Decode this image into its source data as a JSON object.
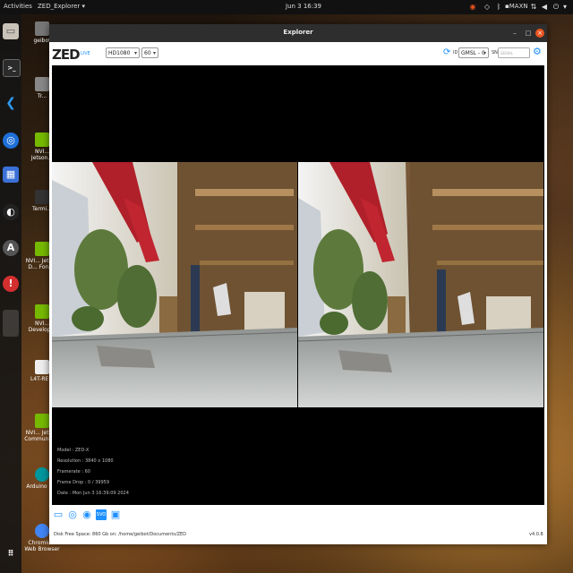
{
  "topbar": {
    "activities": "Activities",
    "app_menu": "ZED_Explorer ▾",
    "clock": "Jun 3 16:39",
    "power_mode": "MAXN",
    "icons": [
      "nvidia-icon",
      "wifi-icon",
      "bluetooth-icon",
      "network-icon",
      "volume-icon",
      "power-icon"
    ]
  },
  "dock": {
    "items": [
      "files-icon",
      "terminal-icon",
      "vscode-icon",
      "chromium-icon",
      "screenshot-icon",
      "obs-icon",
      "arduino-icon",
      "help-icon",
      "apps-grid-icon"
    ]
  },
  "desktop": {
    "icons": [
      {
        "label": "geibot",
        "icon": "home-folder-icon"
      },
      {
        "label": "Tr...",
        "icon": "trash-icon"
      },
      {
        "label": "NVI... Jetson...",
        "icon": "nvidia-icon"
      },
      {
        "label": "Termi...",
        "icon": "terminal-icon"
      },
      {
        "label": "NVI... Jetson D... Foru...",
        "icon": "nvidia-icon"
      },
      {
        "label": "NVI... Develop...",
        "icon": "nvidia-icon"
      },
      {
        "label": "L4T-RE...",
        "icon": "document-icon"
      },
      {
        "label": "NVI... Jetson Community...",
        "icon": "nvidia-icon"
      },
      {
        "label": "Arduino IDE",
        "icon": "arduino-icon"
      },
      {
        "label": "Chromium Web Browser",
        "icon": "chromium-icon"
      }
    ]
  },
  "window": {
    "title": "Explorer",
    "minimize": "–",
    "maximize": "□",
    "close": "×"
  },
  "toolbar": {
    "logo": "ZED",
    "live": "LIVE",
    "resolution": "HD1080",
    "fps": "60",
    "id_label": "ID",
    "camera_id": "GMSL - 0",
    "sn_label": "SN",
    "serial_placeholder": "SERIAL",
    "icons": [
      "refresh-icon",
      "settings-icon"
    ]
  },
  "info": {
    "model": "Model : ZED-X",
    "resolution": "Resolution : 3840 x 1080",
    "framerate": "Framerate : 60",
    "frame_drop": "Frame Drop : 0 / 39959",
    "date": "Date : Mon Jun 3 16:39:09 2024"
  },
  "bottom_toolbar": {
    "icons": [
      "folder-icon",
      "stream-icon",
      "record-icon",
      "svo-icon",
      "snapshot-icon"
    ]
  },
  "status": {
    "disk": "Disk Free Space: 860 Gb  on: /home/geibot/Documents/ZED",
    "version": "v4.0.8"
  },
  "colors": {
    "accent": "#1e90ff",
    "close_button": "#e95420"
  }
}
